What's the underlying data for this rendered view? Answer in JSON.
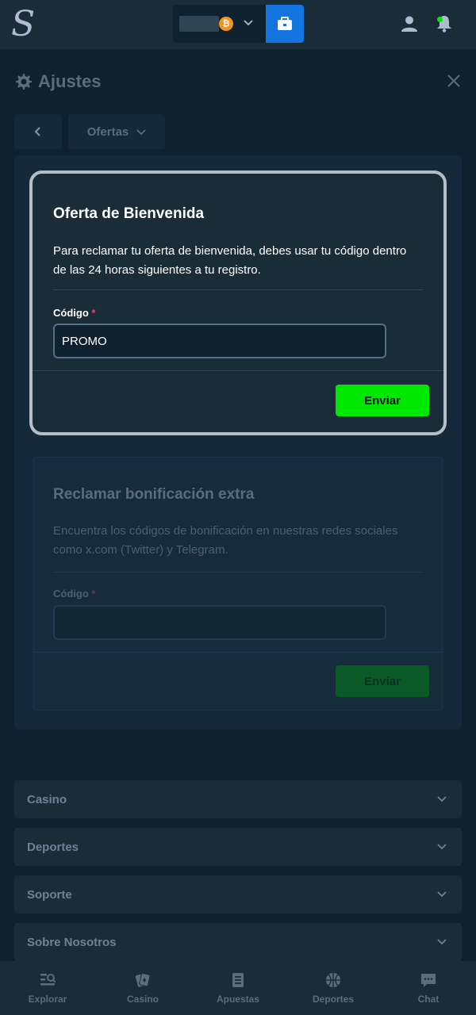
{
  "topbar": {
    "logo_text": "S",
    "currency_symbol": "₿"
  },
  "settings": {
    "title": "Ajustes"
  },
  "offers_dropdown": {
    "label": "Ofertas"
  },
  "welcome_offer": {
    "title": "Oferta de Bienvenida",
    "description": "Para reclamar tu oferta de bienvenida, debes usar tu código dentro de las 24 horas siguientes a tu registro.",
    "field_label": "Código",
    "required_mark": "*",
    "code_value": "PROMO",
    "submit_label": "Enviar"
  },
  "extra_bonus": {
    "title": "Reclamar bonificación extra",
    "description": "Encuentra los códigos de bonificación en nuestras redes sociales como x.com (Twitter) y Telegram.",
    "field_label": "Código",
    "required_mark": "*",
    "code_value": "",
    "submit_label": "Enviar"
  },
  "accordions": [
    {
      "label": "Casino"
    },
    {
      "label": "Deportes"
    },
    {
      "label": "Soporte"
    },
    {
      "label": "Sobre Nosotros"
    }
  ],
  "bottom_nav": [
    {
      "label": "Explorar",
      "icon": "explore-icon"
    },
    {
      "label": "Casino",
      "icon": "cards-icon"
    },
    {
      "label": "Apuestas",
      "icon": "betslip-icon"
    },
    {
      "label": "Deportes",
      "icon": "basketball-icon"
    },
    {
      "label": "Chat",
      "icon": "chat-icon"
    }
  ],
  "colors": {
    "accent_green": "#00e701",
    "wallet_blue": "#1475e1",
    "background": "#0f212e"
  }
}
